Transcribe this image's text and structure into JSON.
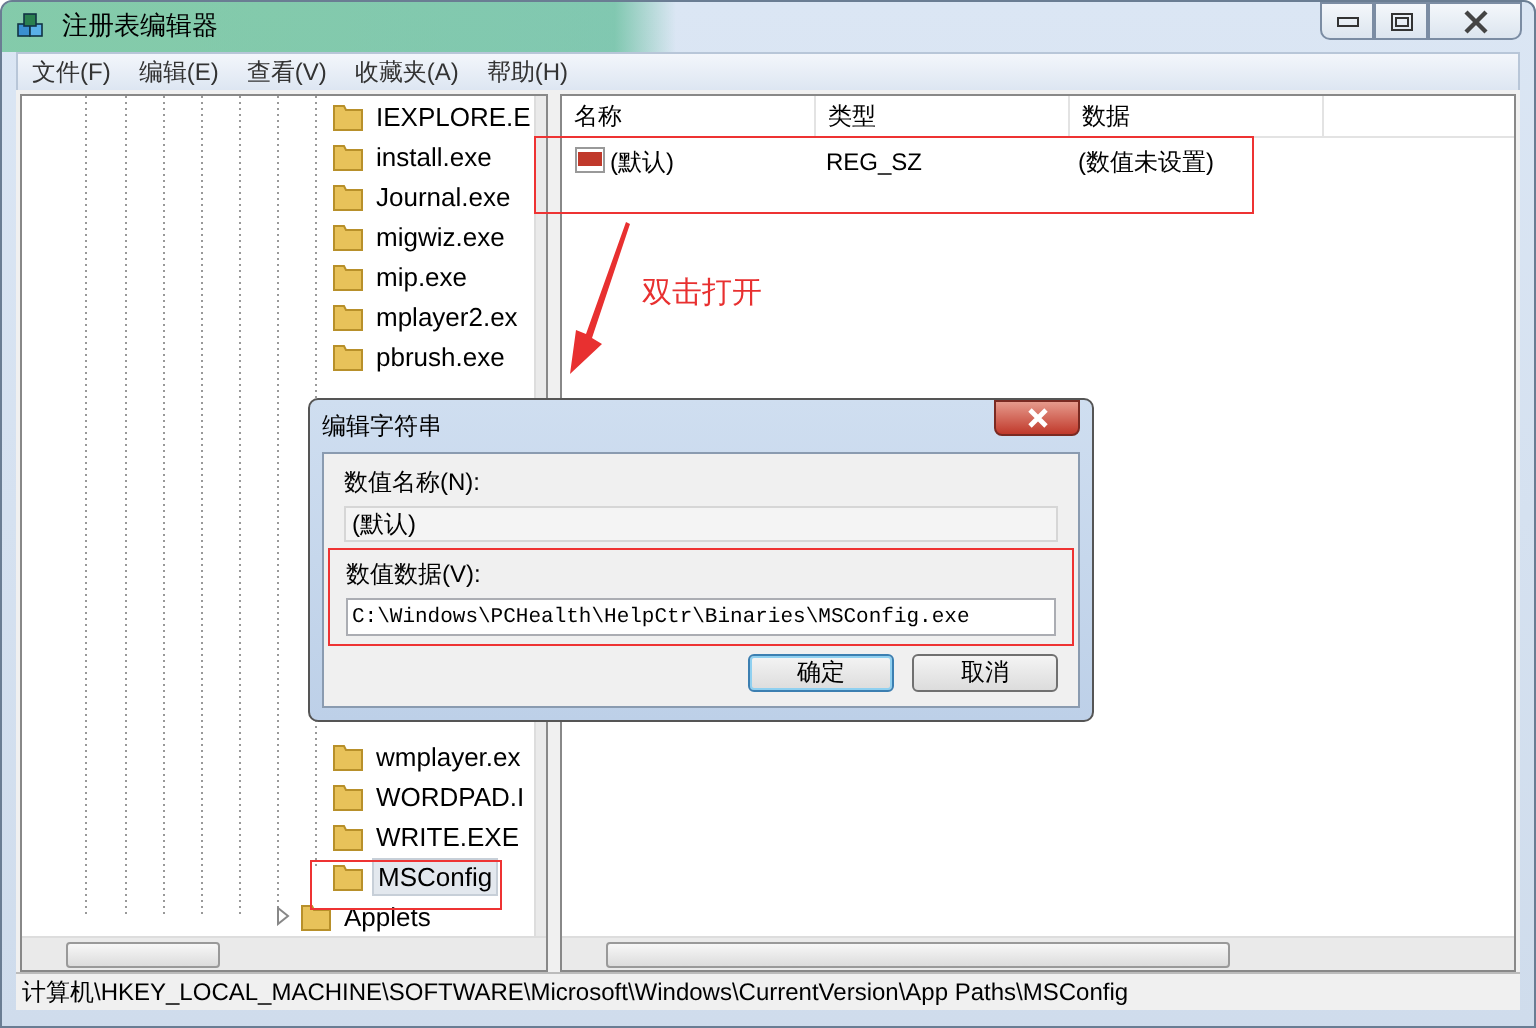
{
  "window": {
    "title": "注册表编辑器"
  },
  "menu": [
    "文件(F)",
    "编辑(E)",
    "查看(V)",
    "收藏夹(A)",
    "帮助(H)"
  ],
  "tree": {
    "items_above_dialog": [
      {
        "label": "IEXPLORE.E",
        "selected": false
      },
      {
        "label": "install.exe",
        "selected": false
      },
      {
        "label": "Journal.exe",
        "selected": false
      },
      {
        "label": "migwiz.exe",
        "selected": false
      },
      {
        "label": "mip.exe",
        "selected": false
      },
      {
        "label": "mplayer2.ex",
        "selected": false
      },
      {
        "label": "pbrush.exe",
        "selected": false
      }
    ],
    "items_below_dialog": [
      {
        "label": "wmplayer.ex",
        "selected": false
      },
      {
        "label": "WORDPAD.I",
        "selected": false
      },
      {
        "label": "WRITE.EXE",
        "selected": false
      },
      {
        "label": "MSConfig",
        "selected": true
      }
    ],
    "sibling_items": [
      {
        "label": "Applets",
        "expanded": false
      }
    ]
  },
  "values": {
    "columns": [
      "名称",
      "类型",
      "数据"
    ],
    "rows": [
      {
        "name": "(默认)",
        "type": "REG_SZ",
        "data": "(数值未设置)"
      }
    ]
  },
  "annotation": {
    "text": "双击打开"
  },
  "dialog": {
    "title": "编辑字符串",
    "name_label": "数值名称(N):",
    "name_value": "(默认)",
    "data_label": "数值数据(V):",
    "data_value": "C:\\Windows\\PCHealth\\HelpCtr\\Binaries\\MSConfig.exe",
    "buttons": [
      {
        "label": "确定",
        "default": true
      },
      {
        "label": "取消",
        "default": false
      }
    ]
  },
  "status_bar": "计算机\\HKEY_LOCAL_MACHINE\\SOFTWARE\\Microsoft\\Windows\\CurrentVersion\\App Paths\\MSConfig"
}
